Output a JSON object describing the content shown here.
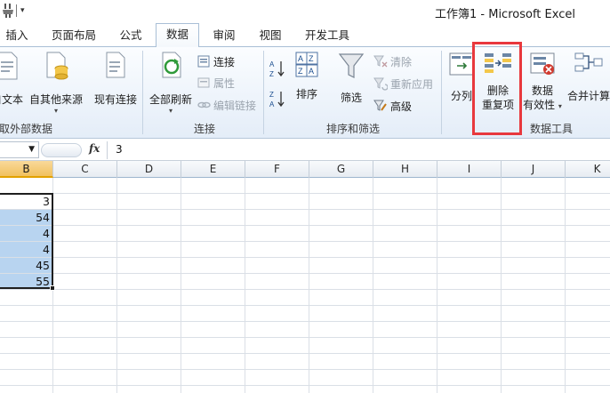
{
  "window": {
    "title": "工作簿1 - Microsoft Excel",
    "quick_access_arrow": "▾"
  },
  "tabs": [
    {
      "label": "插入",
      "active": false
    },
    {
      "label": "页面布局",
      "active": false
    },
    {
      "label": "公式",
      "active": false
    },
    {
      "label": "数据",
      "active": true
    },
    {
      "label": "审阅",
      "active": false
    },
    {
      "label": "视图",
      "active": false
    },
    {
      "label": "开发工具",
      "active": false
    }
  ],
  "ribbon": {
    "groups": {
      "external_data": "取外部数据",
      "connections": "连接",
      "sort_filter": "排序和筛选",
      "data_tools": "数据工具"
    },
    "from_text": "自文本",
    "from_other_sources": "自其他来源",
    "existing_connections": "现有连接",
    "refresh_all": "全部刷新",
    "connections": "连接",
    "properties": "属性",
    "edit_links": "编辑链接",
    "sort": "排序",
    "filter": "筛选",
    "clear": "清除",
    "reapply": "重新应用",
    "advanced": "高级",
    "text_to_columns": "分列",
    "remove_duplicates_line1": "删除",
    "remove_duplicates_line2": "重复项",
    "data_validation_line1": "数据",
    "data_validation_line2": "有效性",
    "consolidate": "合并计算",
    "dropdown_glyph": "▾"
  },
  "highlight_color": "#e8383d",
  "formula_bar": {
    "fx": "fx",
    "value": "3",
    "namebox_arrow": "▼"
  },
  "columns": [
    "B",
    "C",
    "D",
    "E",
    "F",
    "G",
    "H",
    "I",
    "J",
    "K"
  ],
  "column_b_values": [
    "3",
    "54",
    "4",
    "4",
    "45",
    "55"
  ]
}
